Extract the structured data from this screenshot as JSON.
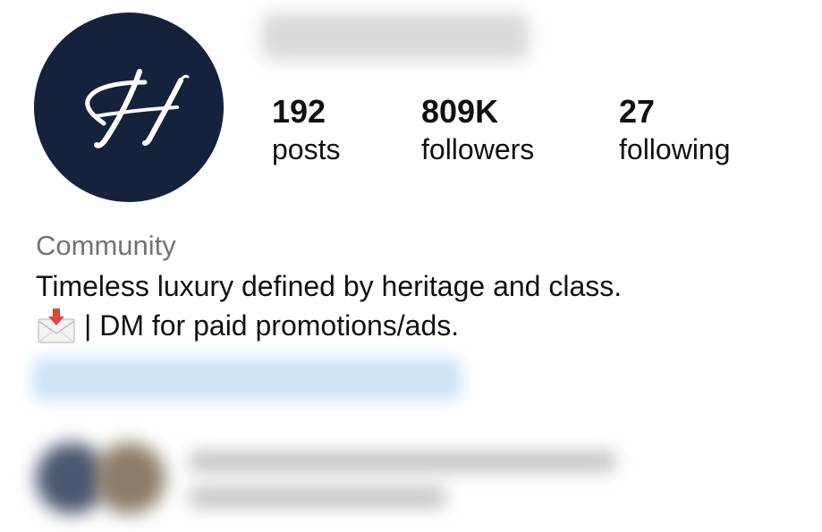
{
  "profile": {
    "username": "",
    "avatar_letter": "H",
    "stats": {
      "posts_count": "192",
      "posts_label": "posts",
      "followers_count": "809K",
      "followers_label": "followers",
      "following_count": "27",
      "following_label": "following"
    },
    "category": "Community",
    "bio_line_1": "Timeless luxury defined by heritage and class.",
    "bio_line_2": "| DM for paid promotions/ads.",
    "bio_emoji_icon": "envelope-with-arrow-icon",
    "link": "",
    "mutual_followers_text": ""
  },
  "colors": {
    "avatar_background": "#16213b",
    "avatar_letter": "#ffffff",
    "category_text": "#737373",
    "link_blue": "#cfe3f7"
  }
}
